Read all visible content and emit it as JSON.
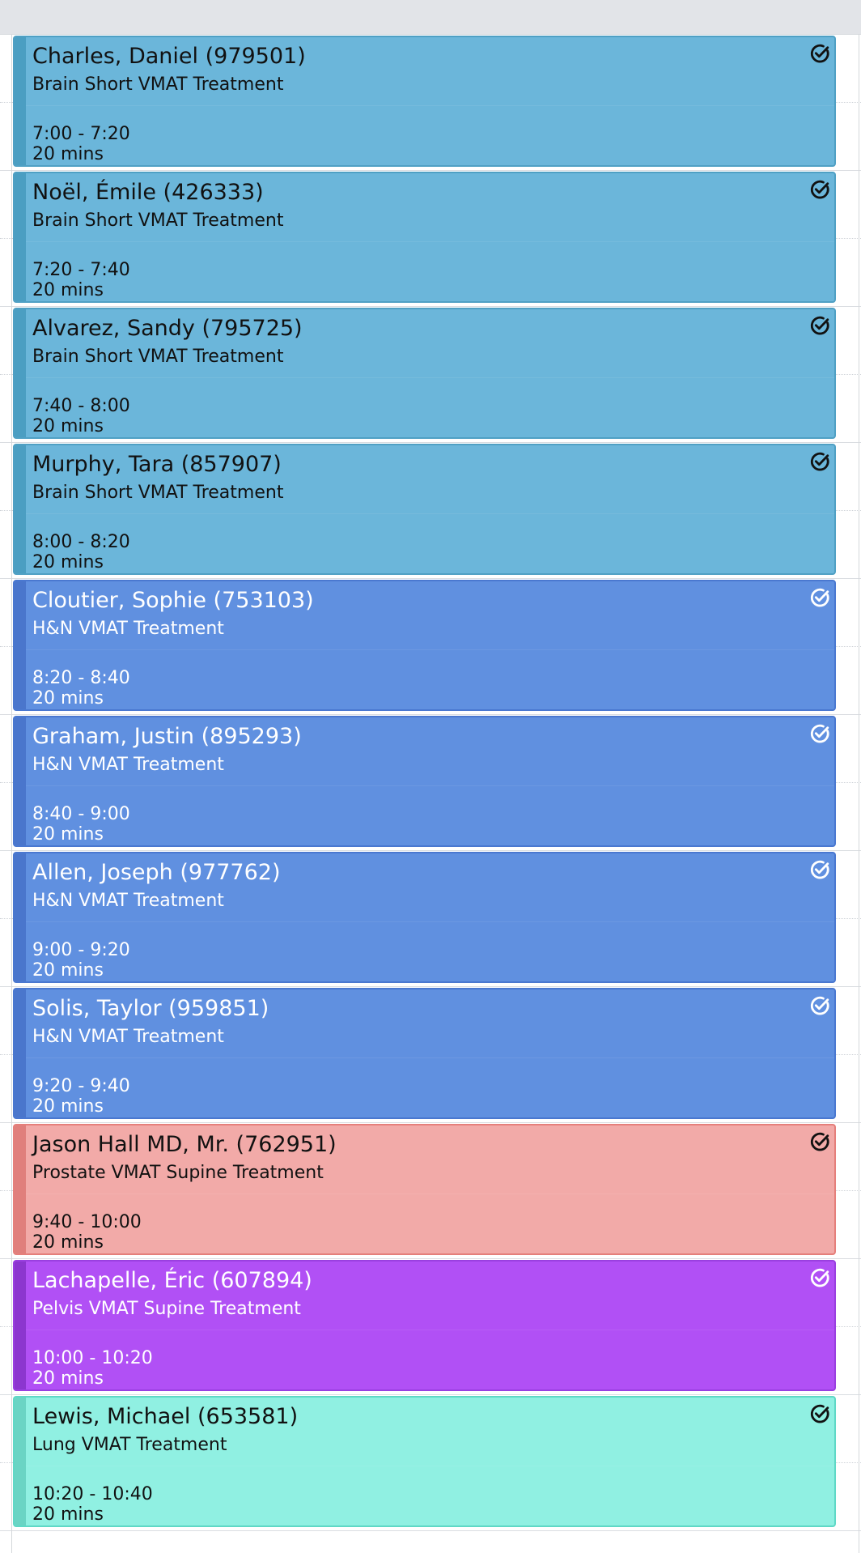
{
  "appointments": [
    {
      "name": "Charles, Daniel (979501)",
      "procedure": "Brain Short VMAT Treatment",
      "time": "7:00 - 7:20",
      "duration": "20 mins",
      "category": "brain",
      "status_icon": "check-circle-icon"
    },
    {
      "name": "Noël, Émile (426333)",
      "procedure": "Brain Short VMAT Treatment",
      "time": "7:20 - 7:40",
      "duration": "20 mins",
      "category": "brain",
      "status_icon": "check-circle-icon"
    },
    {
      "name": "Alvarez, Sandy (795725)",
      "procedure": "Brain Short VMAT Treatment",
      "time": "7:40 - 8:00",
      "duration": "20 mins",
      "category": "brain",
      "status_icon": "check-circle-icon"
    },
    {
      "name": "Murphy, Tara (857907)",
      "procedure": "Brain Short VMAT Treatment",
      "time": "8:00 - 8:20",
      "duration": "20 mins",
      "category": "brain",
      "status_icon": "check-circle-icon"
    },
    {
      "name": "Cloutier, Sophie (753103)",
      "procedure": "H&N VMAT Treatment",
      "time": "8:20 - 8:40",
      "duration": "20 mins",
      "category": "hn",
      "status_icon": "check-circle-icon"
    },
    {
      "name": "Graham, Justin (895293)",
      "procedure": "H&N VMAT Treatment",
      "time": "8:40 - 9:00",
      "duration": "20 mins",
      "category": "hn",
      "status_icon": "check-circle-icon"
    },
    {
      "name": "Allen, Joseph (977762)",
      "procedure": "H&N VMAT Treatment",
      "time": "9:00 - 9:20",
      "duration": "20 mins",
      "category": "hn",
      "status_icon": "check-circle-icon"
    },
    {
      "name": "Solis, Taylor (959851)",
      "procedure": "H&N VMAT Treatment",
      "time": "9:20 - 9:40",
      "duration": "20 mins",
      "category": "hn",
      "status_icon": "check-circle-icon"
    },
    {
      "name": "Jason Hall MD, Mr. (762951)",
      "procedure": "Prostate VMAT Supine Treatment",
      "time": "9:40 - 10:00",
      "duration": "20 mins",
      "category": "prostate",
      "status_icon": "check-circle-icon"
    },
    {
      "name": "Lachapelle, Éric (607894)",
      "procedure": "Pelvis VMAT Supine Treatment",
      "time": "10:00 - 10:20",
      "duration": "20 mins",
      "category": "pelvis",
      "status_icon": "check-circle-icon"
    },
    {
      "name": "Lewis, Michael (653581)",
      "procedure": "Lung VMAT Treatment",
      "time": "10:20 - 10:40",
      "duration": "20 mins",
      "category": "lung",
      "status_icon": "check-circle-icon"
    }
  ],
  "category_colors": {
    "brain": {
      "bg": "#6bb6da",
      "stripe": "#4b9ec2",
      "border": "#4fa0c4",
      "text": "#111111"
    },
    "hn": {
      "bg": "#6090e0",
      "stripe": "#4a76cc",
      "border": "#4a78d0",
      "text": "#ffffff"
    },
    "prostate": {
      "bg": "#f2aaa8",
      "stripe": "#e07f7c",
      "border": "#e57f7b",
      "text": "#111111"
    },
    "pelvis": {
      "bg": "#b150f5",
      "stripe": "#8c36cf",
      "border": "#9a3fe0",
      "text": "#ffffff"
    },
    "lung": {
      "bg": "#90f0e2",
      "stripe": "#6ad4c4",
      "border": "#5fd8c6",
      "text": "#111111"
    }
  }
}
